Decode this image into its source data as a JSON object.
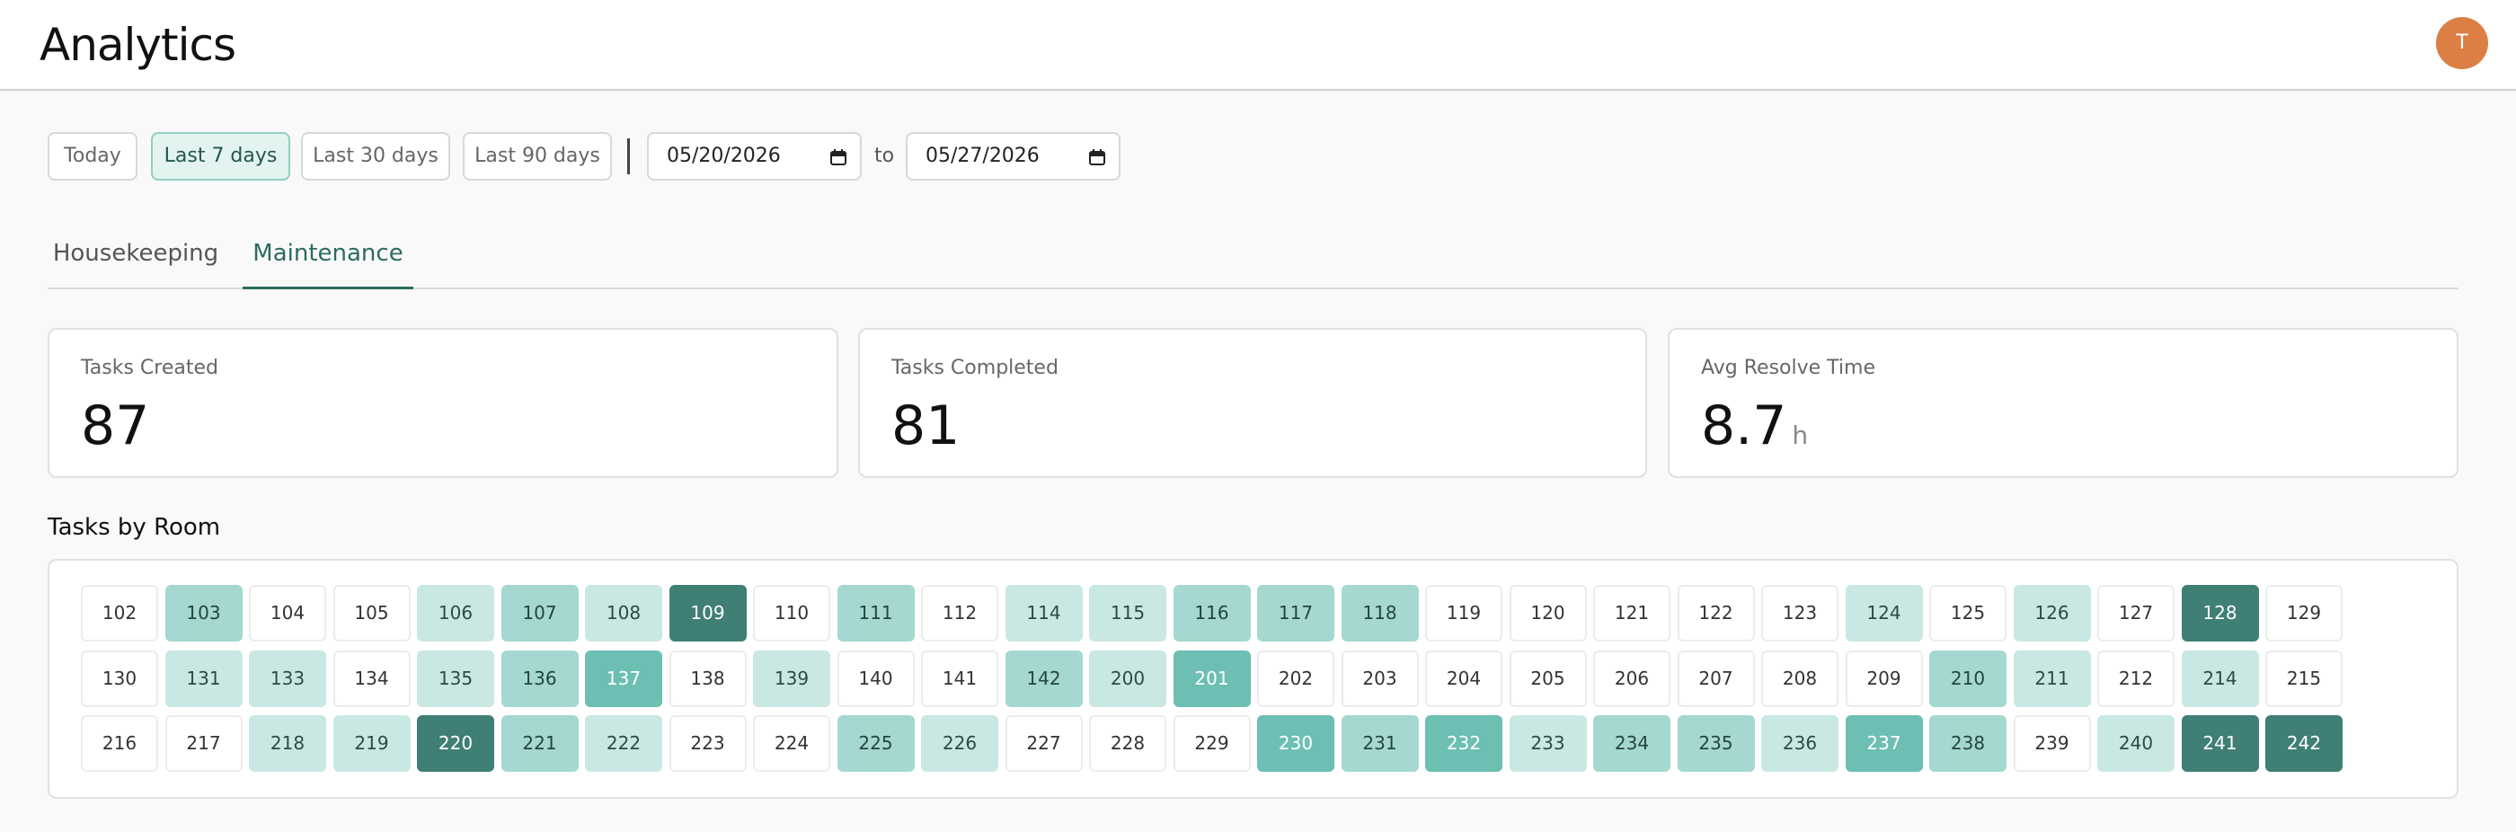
{
  "header": {
    "title": "Analytics",
    "avatar_initial": "T",
    "avatar_color": "#dc7f45"
  },
  "filters": {
    "ranges": [
      {
        "label": "Today",
        "active": false
      },
      {
        "label": "Last 7 days",
        "active": true
      },
      {
        "label": "Last 30 days",
        "active": false
      },
      {
        "label": "Last 90 days",
        "active": false
      }
    ],
    "start_date": "05/20/2026",
    "to_label": "to",
    "end_date": "05/27/2026"
  },
  "tabs": [
    {
      "label": "Housekeeping",
      "active": false
    },
    {
      "label": "Maintenance",
      "active": true
    }
  ],
  "cards": [
    {
      "label": "Tasks Created",
      "value": "87",
      "unit": ""
    },
    {
      "label": "Tasks Completed",
      "value": "81",
      "unit": ""
    },
    {
      "label": "Avg Resolve Time",
      "value": "8.7",
      "unit": "h"
    }
  ],
  "heatmap": {
    "title": "Tasks by Room",
    "colors": {
      "level0": "#ffffff",
      "level1": "#c9e8e3",
      "level2": "#a5d8d0",
      "level3": "#6cbfb2",
      "level4": "#3f7f75"
    },
    "rows": [
      [
        {
          "room": "102",
          "level": 0
        },
        {
          "room": "103",
          "level": 2
        },
        {
          "room": "104",
          "level": 0
        },
        {
          "room": "105",
          "level": 0
        },
        {
          "room": "106",
          "level": 1
        },
        {
          "room": "107",
          "level": 2
        },
        {
          "room": "108",
          "level": 1
        },
        {
          "room": "109",
          "level": 4
        },
        {
          "room": "110",
          "level": 0
        },
        {
          "room": "111",
          "level": 2
        },
        {
          "room": "112",
          "level": 0
        },
        {
          "room": "114",
          "level": 1
        },
        {
          "room": "115",
          "level": 1
        },
        {
          "room": "116",
          "level": 2
        },
        {
          "room": "117",
          "level": 2
        },
        {
          "room": "118",
          "level": 2
        },
        {
          "room": "119",
          "level": 0
        },
        {
          "room": "120",
          "level": 0
        },
        {
          "room": "121",
          "level": 0
        },
        {
          "room": "122",
          "level": 0
        },
        {
          "room": "123",
          "level": 0
        },
        {
          "room": "124",
          "level": 1
        },
        {
          "room": "125",
          "level": 0
        },
        {
          "room": "126",
          "level": 1
        },
        {
          "room": "127",
          "level": 0
        },
        {
          "room": "128",
          "level": 4
        },
        {
          "room": "129",
          "level": 0
        }
      ],
      [
        {
          "room": "130",
          "level": 0
        },
        {
          "room": "131",
          "level": 1
        },
        {
          "room": "133",
          "level": 1
        },
        {
          "room": "134",
          "level": 0
        },
        {
          "room": "135",
          "level": 1
        },
        {
          "room": "136",
          "level": 2
        },
        {
          "room": "137",
          "level": 3
        },
        {
          "room": "138",
          "level": 0
        },
        {
          "room": "139",
          "level": 1
        },
        {
          "room": "140",
          "level": 0
        },
        {
          "room": "141",
          "level": 0
        },
        {
          "room": "142",
          "level": 2
        },
        {
          "room": "200",
          "level": 1
        },
        {
          "room": "201",
          "level": 3
        },
        {
          "room": "202",
          "level": 0
        },
        {
          "room": "203",
          "level": 0
        },
        {
          "room": "204",
          "level": 0
        },
        {
          "room": "205",
          "level": 0
        },
        {
          "room": "206",
          "level": 0
        },
        {
          "room": "207",
          "level": 0
        },
        {
          "room": "208",
          "level": 0
        },
        {
          "room": "209",
          "level": 0
        },
        {
          "room": "210",
          "level": 2
        },
        {
          "room": "211",
          "level": 1
        },
        {
          "room": "212",
          "level": 0
        },
        {
          "room": "214",
          "level": 1
        },
        {
          "room": "215",
          "level": 0
        }
      ],
      [
        {
          "room": "216",
          "level": 0
        },
        {
          "room": "217",
          "level": 0
        },
        {
          "room": "218",
          "level": 1
        },
        {
          "room": "219",
          "level": 1
        },
        {
          "room": "220",
          "level": 4
        },
        {
          "room": "221",
          "level": 2
        },
        {
          "room": "222",
          "level": 1
        },
        {
          "room": "223",
          "level": 0
        },
        {
          "room": "224",
          "level": 0
        },
        {
          "room": "225",
          "level": 2
        },
        {
          "room": "226",
          "level": 1
        },
        {
          "room": "227",
          "level": 0
        },
        {
          "room": "228",
          "level": 0
        },
        {
          "room": "229",
          "level": 0
        },
        {
          "room": "230",
          "level": 3
        },
        {
          "room": "231",
          "level": 2
        },
        {
          "room": "232",
          "level": 3
        },
        {
          "room": "233",
          "level": 1
        },
        {
          "room": "234",
          "level": 2
        },
        {
          "room": "235",
          "level": 2
        },
        {
          "room": "236",
          "level": 1
        },
        {
          "room": "237",
          "level": 3
        },
        {
          "room": "238",
          "level": 2
        },
        {
          "room": "239",
          "level": 0
        },
        {
          "room": "240",
          "level": 1
        },
        {
          "room": "241",
          "level": 4
        },
        {
          "room": "242",
          "level": 4
        }
      ]
    ]
  }
}
